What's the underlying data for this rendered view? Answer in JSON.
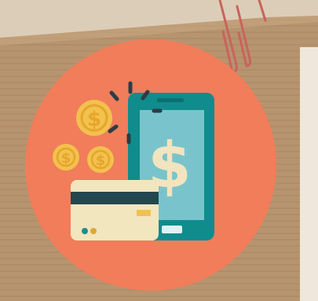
{
  "scene": {
    "subject": "money-payment-badge-icon",
    "colors": {
      "backdrop": "#dccdb8",
      "cardboard": "#b79470",
      "cardboard_dark": "#a8845f",
      "paperclip": "#c8645c",
      "circle": "#f17d5a",
      "phone_body": "#108c8c",
      "phone_screen": "#79c4cc",
      "dollar_light": "#f2e4be",
      "coin": "#f2c14e",
      "coin_symbol": "#e6a52c",
      "card": "#f2e6bf",
      "card_stripe": "#23474f",
      "card_chip": "#f2c14e",
      "card_dot_teal": "#1d8f8e",
      "card_dot_gold": "#e0a63a",
      "spark": "#2b3d45"
    },
    "icons": [
      "paperclip-icon",
      "smartphone-icon",
      "dollar-sign-icon",
      "gold-coin-icon",
      "credit-card-icon",
      "sparkle-rays-icon"
    ]
  }
}
